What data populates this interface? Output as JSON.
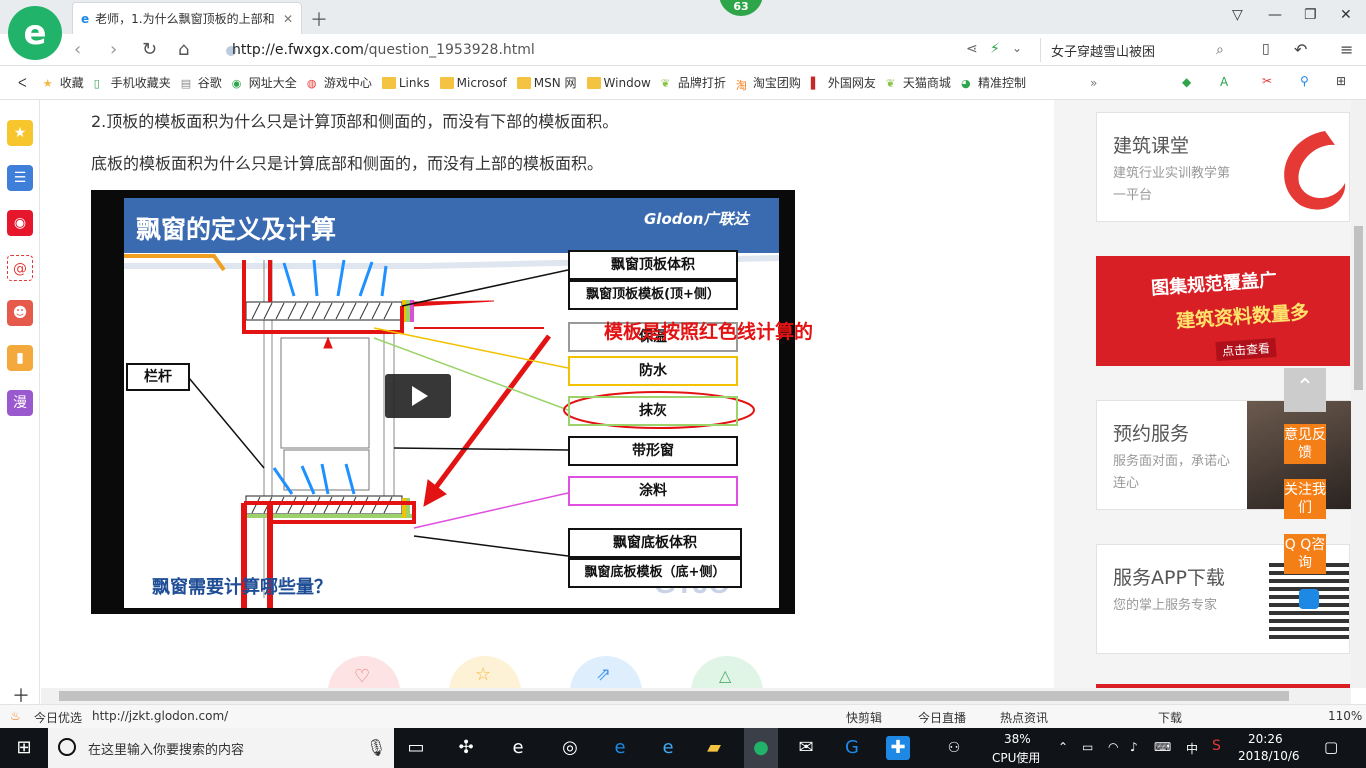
{
  "browser": {
    "badge": "63",
    "tab_title": "老师，1.为什么飘窗顶板的上部和",
    "url_host": "http://e.fwxgx.com",
    "url_path": "/question_1953928.html",
    "search_text": "女子穿越雪山被困",
    "logo_letter": "e"
  },
  "bookmarks": [
    {
      "label": "收藏",
      "icon": "star-icon"
    },
    {
      "label": "手机收藏夹",
      "icon": "phone-icon"
    },
    {
      "label": "谷歌",
      "icon": "page-icon"
    },
    {
      "label": "网址大全",
      "icon": "globe-icon"
    },
    {
      "label": "游戏中心",
      "icon": "game-icon"
    },
    {
      "label": "Links",
      "icon": "folder-icon"
    },
    {
      "label": "Microsof",
      "icon": "folder-icon"
    },
    {
      "label": "MSN 网",
      "icon": "folder-icon"
    },
    {
      "label": "Window",
      "icon": "folder-icon"
    },
    {
      "label": "品牌打折",
      "icon": "leaf-icon"
    },
    {
      "label": "淘宝团购",
      "icon": "taobao-icon"
    },
    {
      "label": "外国网友",
      "icon": "bookmark-icon"
    },
    {
      "label": "天猫商城",
      "icon": "leaf-icon"
    },
    {
      "label": "精准控制",
      "icon": "chat-icon"
    }
  ],
  "article": {
    "line1": "2.顶板的模板面积为什么只是计算顶部和侧面的，而没有下部的模板面积。",
    "line2": "底板的模板面积为什么只是计算底部和侧面的，而没有上部的模板面积。"
  },
  "slide": {
    "title": "飘窗的定义及计算",
    "brand": "Glodon广联达",
    "labels": {
      "top_volume": "飘窗顶板体积",
      "top_formwork": "飘窗顶板模板(顶+侧）",
      "insulation": "保温",
      "waterproof": "防水",
      "plaster": "抹灰",
      "strip_window": "带形窗",
      "paint": "涂料",
      "bottom_volume": "飘窗底板体积",
      "bottom_formwork": "飘窗底板模板（底+侧）",
      "railing": "栏杆"
    },
    "footer_question": "飘窗需要计算哪些量？",
    "annotation": "模板是按照红色线计算的"
  },
  "sidebar": {
    "cards": [
      {
        "title": "建筑课堂",
        "desc": "建筑行业实训教学第一平台"
      },
      {
        "title": "图集规范覆盖广",
        "subtitle": "建筑资料数量多",
        "cta": "点击查看"
      },
      {
        "title": "预约服务",
        "desc": "服务面对面，承诺心连心"
      },
      {
        "title": "服务APP下载",
        "desc": "您的掌上服务专家"
      }
    ],
    "float_buttons": [
      "意见反馈",
      "关注我们",
      "Q Q咨询"
    ]
  },
  "statusbar": {
    "left_label": "今日优选",
    "hover_url": "http://jzkt.glodon.com/",
    "items": [
      "快剪辑",
      "今日直播",
      "热点资讯",
      "下载"
    ],
    "zoom": "110%"
  },
  "taskbar": {
    "search_placeholder": "在这里输入你要搜索的内容",
    "cpu_percent": "38%",
    "cpu_label": "CPU使用",
    "ime": "中",
    "time": "20:26",
    "date": "2018/10/6"
  },
  "colors": {
    "accent": "#21b36a",
    "annotation_red": "#e41313",
    "float_orange": "#f57f17"
  }
}
